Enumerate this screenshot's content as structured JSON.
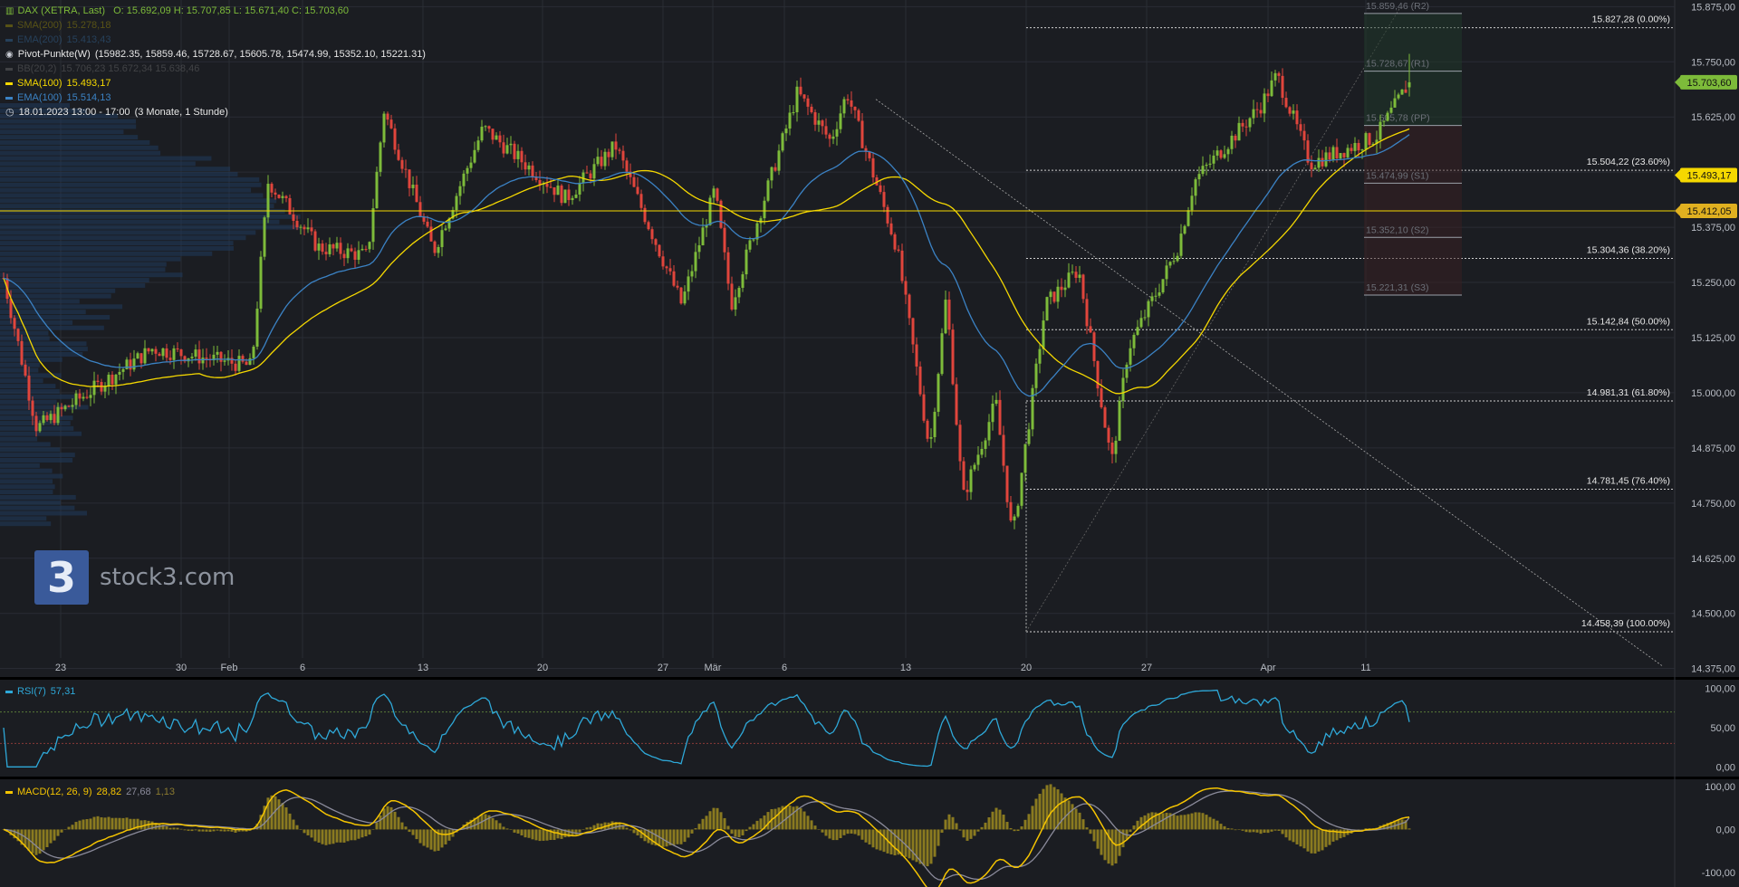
{
  "header": {
    "instrument": "DAX (XETRA, Last)",
    "ohlc": "O: 15.692,09   H: 15.707,85   L: 15.671,40   C: 15.703,60"
  },
  "legend": [
    {
      "label": "SMA(200)",
      "value": "15.278,18",
      "color": "#c8b400",
      "dim": true
    },
    {
      "label": "EMA(200)",
      "value": "15.413,43",
      "color": "#3b82c4",
      "dim": true
    },
    {
      "label": "Pivot-Punkte(W)",
      "value": "(15982.35,  15859.46,  15728.67,  15605.78,  15474.99,  15352.10,  15221.31)",
      "color": "#ffffff",
      "dim": false,
      "marker": "circle"
    },
    {
      "label": "BB(20,2)",
      "value": "15.706,23  15.672,34  15.638,46",
      "color": "#888888",
      "dim": true
    },
    {
      "label": "SMA(100)",
      "value": "15.493,17",
      "color": "#f5d800",
      "dim": false
    },
    {
      "label": "EMA(100)",
      "value": "15.514,13",
      "color": "#3b82c4",
      "dim": false
    },
    {
      "label": "18.01.2023 13:00 - 17:00",
      "value": "(3 Monate, 1 Stunde)",
      "color": "#ffffff",
      "dim": false,
      "marker": "clock"
    }
  ],
  "logo": {
    "mark": "3",
    "text": "stock3.com"
  },
  "colors": {
    "bg": "#1b1d22",
    "grid": "#2a2d34",
    "up": "#7dbb3a",
    "down": "#e0453c",
    "sma": "#f5d800",
    "ema": "#3b82c4",
    "rsi": "#2ea8d8",
    "macd": "#f5c400",
    "signal": "#8a8a9a"
  },
  "chart_data": [
    {
      "type": "candlestick",
      "title": "DAX (XETRA, Last)",
      "y_axis_ticks": [
        "15.875,00",
        "15.750,00",
        "15.625,00",
        "15.500,00",
        "15.375,00",
        "15.250,00",
        "15.125,00",
        "15.000,00",
        "14.875,00",
        "14.750,00",
        "14.625,00",
        "14.500,00",
        "14.375,00"
      ],
      "ylim": [
        14362,
        15890
      ],
      "x_ticks": [
        "23",
        "30",
        "Feb",
        "6",
        "13",
        "20",
        "27",
        "Mär",
        "6",
        "13",
        "20",
        "27",
        "Apr",
        "11"
      ],
      "last_price_label": "15.703,60",
      "sma100_price_label": "15.493,17",
      "level_price_label": "15.412,05",
      "horizontal_level": 15412.05,
      "fibonacci": [
        {
          "label": "15.827,28 (0.00%)",
          "value": 15827.28
        },
        {
          "label": "15.504,22 (23.60%)",
          "value": 15504.22
        },
        {
          "label": "15.304,36 (38.20%)",
          "value": 15304.36
        },
        {
          "label": "15.142,84 (50.00%)",
          "value": 15142.84
        },
        {
          "label": "14.981,31 (61.80%)",
          "value": 14981.31
        },
        {
          "label": "14.781,45 (76.40%)",
          "value": 14781.45
        },
        {
          "label": "14.458,39 (100.00%)",
          "value": 14458.39
        }
      ],
      "pivots": [
        {
          "label": "15.859,46 (R2)",
          "value": 15859.46
        },
        {
          "label": "15.728,67 (R1)",
          "value": 15728.67
        },
        {
          "label": "15.605,78 (PP)",
          "value": 15605.78
        },
        {
          "label": "15.474,99 (S1)",
          "value": 15474.99
        },
        {
          "label": "15.352,10 (S2)",
          "value": 15352.1
        },
        {
          "label": "15.221,31 (S3)",
          "value": 15221.31
        }
      ],
      "ohlc_last": {
        "open": 15692.09,
        "high": 15707.85,
        "low": 15671.4,
        "close": 15703.6
      },
      "path_anchors": [
        {
          "x": "18.01.",
          "close": 15260
        },
        {
          "x": "20.01.",
          "close": 14920
        },
        {
          "x": "27.01.",
          "close": 15100
        },
        {
          "x": "02.02.",
          "close": 15060
        },
        {
          "x": "03.02.",
          "close": 15480
        },
        {
          "x": "06.02.",
          "close": 15330
        },
        {
          "x": "09.02.",
          "close": 15310
        },
        {
          "x": "10.02.",
          "close": 15640
        },
        {
          "x": "13.02.",
          "close": 15320
        },
        {
          "x": "16.02.",
          "close": 15600
        },
        {
          "x": "21.02.",
          "close": 15440
        },
        {
          "x": "24.02.",
          "close": 15560
        },
        {
          "x": "28.02.",
          "close": 15200
        },
        {
          "x": "02.03.",
          "close": 15460
        },
        {
          "x": "03.03.",
          "close": 15200
        },
        {
          "x": "07.03.",
          "close": 15680
        },
        {
          "x": "09.03.",
          "close": 15570
        },
        {
          "x": "10.03.",
          "close": 15680
        },
        {
          "x": "13.03.",
          "close": 15330
        },
        {
          "x": "15.03.",
          "close": 14870
        },
        {
          "x": "16.03.",
          "close": 15220
        },
        {
          "x": "17.03.",
          "close": 14760
        },
        {
          "x": "19.03.",
          "close": 14980
        },
        {
          "x": "20.03.",
          "close": 14670
        },
        {
          "x": "22.03.",
          "close": 15200
        },
        {
          "x": "24.03.",
          "close": 15280
        },
        {
          "x": "26.03.",
          "close": 14840
        },
        {
          "x": "27.03.",
          "close": 15100
        },
        {
          "x": "29.03.",
          "close": 15250
        },
        {
          "x": "30.03.",
          "close": 15330
        },
        {
          "x": "31.03.",
          "close": 15480
        },
        {
          "x": "04.04.",
          "close": 15650
        },
        {
          "x": "05.04.",
          "close": 15720
        },
        {
          "x": "07.04.",
          "close": 15520
        },
        {
          "x": "11.04.",
          "close": 15580
        },
        {
          "x": "13.04.",
          "close": 15703.6
        }
      ]
    },
    {
      "type": "line",
      "title": "RSI(7)",
      "value_label": "57,31",
      "y_axis_ticks": [
        "100,00",
        "50,00",
        "0,00"
      ],
      "ylim": [
        -10,
        110
      ],
      "levels": [
        70,
        30
      ]
    },
    {
      "type": "line",
      "title": "MACD(12, 26, 9)",
      "value_labels": [
        "28,82",
        "27,68",
        "1,13"
      ],
      "y_axis_ticks": [
        "100,00",
        "0,00",
        "-100,00"
      ],
      "ylim": [
        -130,
        115
      ]
    }
  ]
}
